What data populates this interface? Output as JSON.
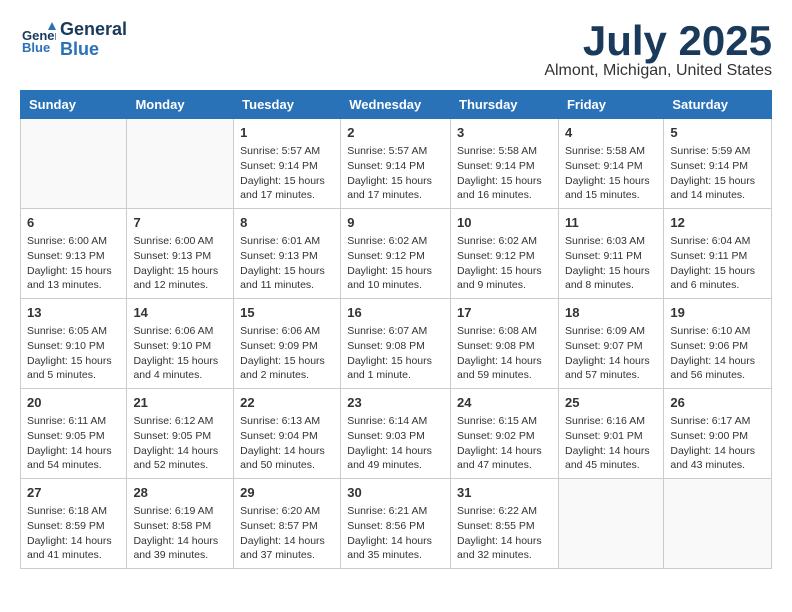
{
  "header": {
    "logo_line1": "General",
    "logo_line2": "Blue",
    "title": "July 2025",
    "subtitle": "Almont, Michigan, United States"
  },
  "days_of_week": [
    "Sunday",
    "Monday",
    "Tuesday",
    "Wednesday",
    "Thursday",
    "Friday",
    "Saturday"
  ],
  "weeks": [
    [
      {
        "day": null
      },
      {
        "day": null
      },
      {
        "day": 1,
        "sunrise": "5:57 AM",
        "sunset": "9:14 PM",
        "daylight": "15 hours and 17 minutes."
      },
      {
        "day": 2,
        "sunrise": "5:57 AM",
        "sunset": "9:14 PM",
        "daylight": "15 hours and 17 minutes."
      },
      {
        "day": 3,
        "sunrise": "5:58 AM",
        "sunset": "9:14 PM",
        "daylight": "15 hours and 16 minutes."
      },
      {
        "day": 4,
        "sunrise": "5:58 AM",
        "sunset": "9:14 PM",
        "daylight": "15 hours and 15 minutes."
      },
      {
        "day": 5,
        "sunrise": "5:59 AM",
        "sunset": "9:14 PM",
        "daylight": "15 hours and 14 minutes."
      }
    ],
    [
      {
        "day": 6,
        "sunrise": "6:00 AM",
        "sunset": "9:13 PM",
        "daylight": "15 hours and 13 minutes."
      },
      {
        "day": 7,
        "sunrise": "6:00 AM",
        "sunset": "9:13 PM",
        "daylight": "15 hours and 12 minutes."
      },
      {
        "day": 8,
        "sunrise": "6:01 AM",
        "sunset": "9:13 PM",
        "daylight": "15 hours and 11 minutes."
      },
      {
        "day": 9,
        "sunrise": "6:02 AM",
        "sunset": "9:12 PM",
        "daylight": "15 hours and 10 minutes."
      },
      {
        "day": 10,
        "sunrise": "6:02 AM",
        "sunset": "9:12 PM",
        "daylight": "15 hours and 9 minutes."
      },
      {
        "day": 11,
        "sunrise": "6:03 AM",
        "sunset": "9:11 PM",
        "daylight": "15 hours and 8 minutes."
      },
      {
        "day": 12,
        "sunrise": "6:04 AM",
        "sunset": "9:11 PM",
        "daylight": "15 hours and 6 minutes."
      }
    ],
    [
      {
        "day": 13,
        "sunrise": "6:05 AM",
        "sunset": "9:10 PM",
        "daylight": "15 hours and 5 minutes."
      },
      {
        "day": 14,
        "sunrise": "6:06 AM",
        "sunset": "9:10 PM",
        "daylight": "15 hours and 4 minutes."
      },
      {
        "day": 15,
        "sunrise": "6:06 AM",
        "sunset": "9:09 PM",
        "daylight": "15 hours and 2 minutes."
      },
      {
        "day": 16,
        "sunrise": "6:07 AM",
        "sunset": "9:08 PM",
        "daylight": "15 hours and 1 minute."
      },
      {
        "day": 17,
        "sunrise": "6:08 AM",
        "sunset": "9:08 PM",
        "daylight": "14 hours and 59 minutes."
      },
      {
        "day": 18,
        "sunrise": "6:09 AM",
        "sunset": "9:07 PM",
        "daylight": "14 hours and 57 minutes."
      },
      {
        "day": 19,
        "sunrise": "6:10 AM",
        "sunset": "9:06 PM",
        "daylight": "14 hours and 56 minutes."
      }
    ],
    [
      {
        "day": 20,
        "sunrise": "6:11 AM",
        "sunset": "9:05 PM",
        "daylight": "14 hours and 54 minutes."
      },
      {
        "day": 21,
        "sunrise": "6:12 AM",
        "sunset": "9:05 PM",
        "daylight": "14 hours and 52 minutes."
      },
      {
        "day": 22,
        "sunrise": "6:13 AM",
        "sunset": "9:04 PM",
        "daylight": "14 hours and 50 minutes."
      },
      {
        "day": 23,
        "sunrise": "6:14 AM",
        "sunset": "9:03 PM",
        "daylight": "14 hours and 49 minutes."
      },
      {
        "day": 24,
        "sunrise": "6:15 AM",
        "sunset": "9:02 PM",
        "daylight": "14 hours and 47 minutes."
      },
      {
        "day": 25,
        "sunrise": "6:16 AM",
        "sunset": "9:01 PM",
        "daylight": "14 hours and 45 minutes."
      },
      {
        "day": 26,
        "sunrise": "6:17 AM",
        "sunset": "9:00 PM",
        "daylight": "14 hours and 43 minutes."
      }
    ],
    [
      {
        "day": 27,
        "sunrise": "6:18 AM",
        "sunset": "8:59 PM",
        "daylight": "14 hours and 41 minutes."
      },
      {
        "day": 28,
        "sunrise": "6:19 AM",
        "sunset": "8:58 PM",
        "daylight": "14 hours and 39 minutes."
      },
      {
        "day": 29,
        "sunrise": "6:20 AM",
        "sunset": "8:57 PM",
        "daylight": "14 hours and 37 minutes."
      },
      {
        "day": 30,
        "sunrise": "6:21 AM",
        "sunset": "8:56 PM",
        "daylight": "14 hours and 35 minutes."
      },
      {
        "day": 31,
        "sunrise": "6:22 AM",
        "sunset": "8:55 PM",
        "daylight": "14 hours and 32 minutes."
      },
      {
        "day": null
      },
      {
        "day": null
      }
    ]
  ],
  "labels": {
    "sunrise": "Sunrise:",
    "sunset": "Sunset:",
    "daylight": "Daylight:"
  }
}
